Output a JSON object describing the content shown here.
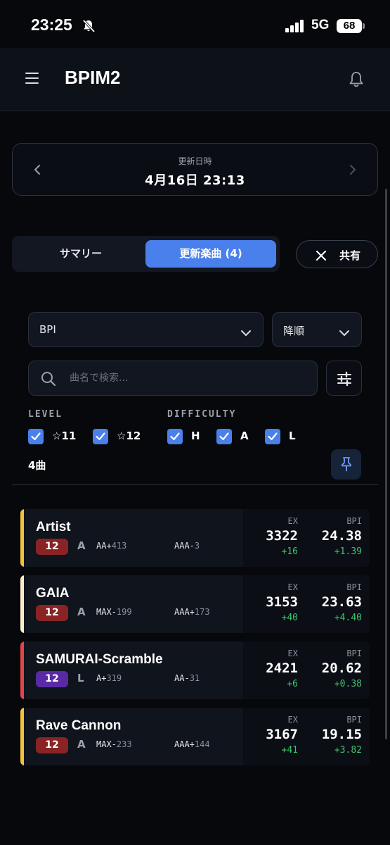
{
  "status_bar": {
    "time": "23:25",
    "network": "5G",
    "battery": "68"
  },
  "header": {
    "title": "BPIM2"
  },
  "date_card": {
    "label": "更新日時",
    "value": "4月16日 23:13"
  },
  "tabs": [
    {
      "label": "サマリー",
      "active": false
    },
    {
      "label": "更新楽曲 (4)",
      "active": true
    }
  ],
  "share_button": {
    "label": "共有"
  },
  "sort_select": {
    "value": "BPI"
  },
  "order_select": {
    "value": "降順"
  },
  "search": {
    "placeholder": "曲名で検索..."
  },
  "filters": {
    "level_label": "LEVEL",
    "difficulty_label": "DIFFICULTY",
    "levels": [
      {
        "label": "☆11",
        "checked": true
      },
      {
        "label": "☆12",
        "checked": true
      }
    ],
    "difficulties": [
      {
        "label": "H",
        "checked": true
      },
      {
        "label": "A",
        "checked": true
      },
      {
        "label": "L",
        "checked": true
      }
    ]
  },
  "result_count": "4曲",
  "stat_labels": {
    "ex": "EX",
    "bpi": "BPI"
  },
  "colors": {
    "accent": "#4a80ec",
    "positive": "#3ec46d",
    "badge_red": "#8a2424",
    "badge_purple": "#5a2aa6",
    "clear_yellow": "#f2c23a",
    "clear_cream": "#f7efc9",
    "clear_red": "#e0464a"
  },
  "songs": [
    {
      "title": "Artist",
      "level": "12",
      "difficulty": "A",
      "badge_color": "#8a2424",
      "clear_color": "#f2c23a",
      "grade1_key": "AA+",
      "grade1_val": "413",
      "grade2_key": "AAA-",
      "grade2_val": "3",
      "ex": "3322",
      "ex_diff": "+16",
      "bpi": "24.38",
      "bpi_diff": "+1.39"
    },
    {
      "title": "GAIA",
      "level": "12",
      "difficulty": "A",
      "badge_color": "#8a2424",
      "clear_color": "#f7efc9",
      "grade1_key": "MAX-",
      "grade1_val": "199",
      "grade2_key": "AAA+",
      "grade2_val": "173",
      "ex": "3153",
      "ex_diff": "+40",
      "bpi": "23.63",
      "bpi_diff": "+4.40"
    },
    {
      "title": "SAMURAI-Scramble",
      "level": "12",
      "difficulty": "L",
      "badge_color": "#5a2aa6",
      "clear_color": "#e0464a",
      "grade1_key": "A+",
      "grade1_val": "319",
      "grade2_key": "AA-",
      "grade2_val": "31",
      "ex": "2421",
      "ex_diff": "+6",
      "bpi": "20.62",
      "bpi_diff": "+0.38"
    },
    {
      "title": "Rave Cannon",
      "level": "12",
      "difficulty": "A",
      "badge_color": "#8a2424",
      "clear_color": "#f2c23a",
      "grade1_key": "MAX-",
      "grade1_val": "233",
      "grade2_key": "AAA+",
      "grade2_val": "144",
      "ex": "3167",
      "ex_diff": "+41",
      "bpi": "19.15",
      "bpi_diff": "+3.82"
    }
  ]
}
